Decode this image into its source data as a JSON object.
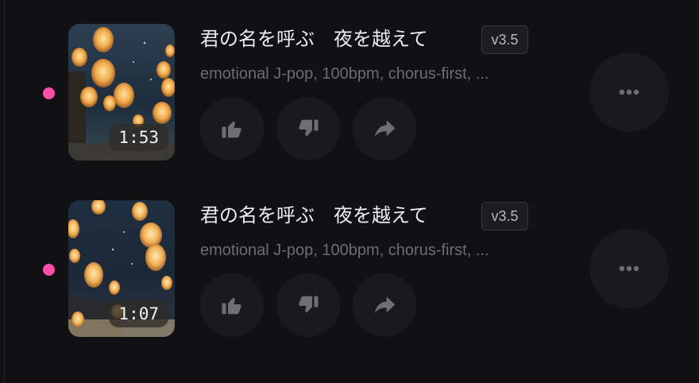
{
  "songs": [
    {
      "title": "君の名を呼ぶ　夜を越えて",
      "version": "v3.5",
      "tags": "emotional J-pop, 100bpm, chorus-first, ...",
      "duration": "1:53"
    },
    {
      "title": "君の名を呼ぶ　夜を越えて",
      "version": "v3.5",
      "tags": "emotional J-pop, 100bpm, chorus-first, ...",
      "duration": "1:07"
    }
  ],
  "icons": {
    "like": "thumbs-up-icon",
    "dislike": "thumbs-down-icon",
    "share": "share-arrow-icon",
    "more": "more-dots-icon"
  },
  "colors": {
    "background": "#111113",
    "status_dot": "#ff4fa8",
    "action_bg": "#1a1a1c",
    "icon": "#6e6e73"
  }
}
